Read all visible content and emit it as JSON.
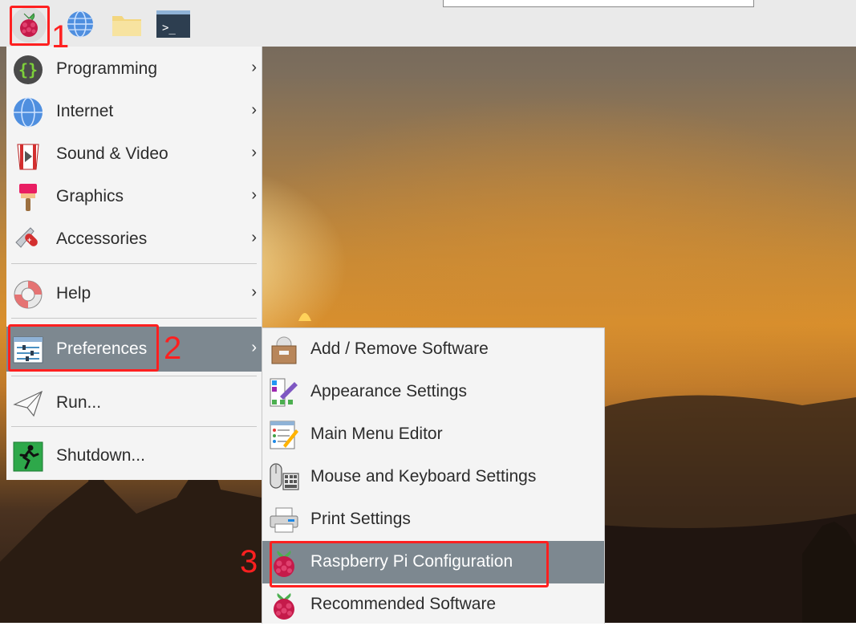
{
  "taskbar": {
    "icons": [
      "raspberry-menu-icon",
      "web-browser-icon",
      "file-manager-icon",
      "terminal-icon"
    ]
  },
  "main_menu": {
    "items": [
      {
        "label": "Programming",
        "icon": "programming-braces-icon",
        "has_submenu": true
      },
      {
        "label": "Internet",
        "icon": "globe-icon",
        "has_submenu": true
      },
      {
        "label": "Sound & Video",
        "icon": "popcorn-icon",
        "has_submenu": true
      },
      {
        "label": "Graphics",
        "icon": "paintbrush-icon",
        "has_submenu": true
      },
      {
        "label": "Accessories",
        "icon": "swiss-knife-icon",
        "has_submenu": true
      },
      {
        "label": "Help",
        "icon": "lifebuoy-icon",
        "has_submenu": true
      },
      {
        "label": "Preferences",
        "icon": "sliders-icon",
        "has_submenu": true,
        "active": true
      },
      {
        "label": "Run...",
        "icon": "paper-plane-icon",
        "has_submenu": false
      },
      {
        "label": "Shutdown...",
        "icon": "exit-running-man-icon",
        "has_submenu": false
      }
    ],
    "submenu_arrow": "›"
  },
  "preferences_menu": {
    "items": [
      {
        "label": "Add / Remove Software",
        "icon": "package-icon"
      },
      {
        "label": "Appearance Settings",
        "icon": "palette-icon"
      },
      {
        "label": "Main Menu Editor",
        "icon": "menu-editor-icon"
      },
      {
        "label": "Mouse and Keyboard Settings",
        "icon": "mouse-keyboard-icon"
      },
      {
        "label": "Print Settings",
        "icon": "printer-icon"
      },
      {
        "label": "Raspberry Pi Configuration",
        "icon": "raspberry-icon",
        "active": true
      },
      {
        "label": "Recommended Software",
        "icon": "raspberry-icon"
      }
    ]
  },
  "annotations": {
    "step1": "1",
    "step2": "2",
    "step3": "3",
    "color": "#ff2020"
  },
  "colors": {
    "menu_bg": "#f4f4f4",
    "highlight_bg": "#7d8890",
    "taskbar_bg": "#eaeaea"
  }
}
